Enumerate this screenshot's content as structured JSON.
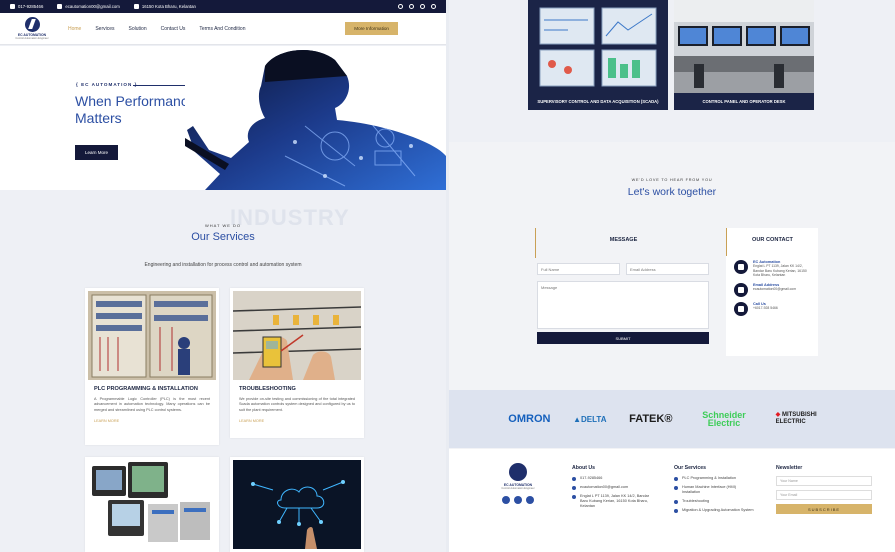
{
  "topbar": {
    "phone": "017-9285466",
    "email": "ecautomation00@gmail.com",
    "address": "16150 Kota Bharu, Kelantan"
  },
  "nav": {
    "brand": "EC AUTOMATION",
    "brand_sub": "Control Automation Engineer",
    "items": [
      "Home",
      "Services",
      "Solution",
      "Contact Us",
      "Terms And Condition"
    ],
    "active": "Home",
    "more_button": "More Information"
  },
  "hero": {
    "tag": "EC AUTOMATION",
    "title": "When Performance Matters",
    "button": "Learn More"
  },
  "services": {
    "kicker": "WHAT WE DO",
    "title": "Our Services",
    "watermark": "INDUSTRY",
    "description": "Engineering and installation for process control and automation system",
    "cards": [
      {
        "title": "PLC PROGRAMMING & INSTALLATION",
        "text": "A Programmable Logic Controller (PLC) is the most recent advancement in automation technology. Many operations can be merged and streamlined using PLC control systems.",
        "link": "LEARN MORE"
      },
      {
        "title": "TROUBLESHOOTING",
        "text": "We provide on-site testing and commissioning of the total integrated Scada automation controls system designed and configured by us to suit the plant requirement.",
        "link": "LEARN MORE"
      }
    ]
  },
  "showcase": [
    {
      "caption": "SUPERVISORY CONTROL AND DATA ACQUISITION (SCADA)"
    },
    {
      "caption": "CONTROL PANEL AND OPERATOR DESK"
    }
  ],
  "contact": {
    "kicker": "WE'D LOVE TO HEAR FROM YOU",
    "title": "Let's work together",
    "form_title": "MESSAGE",
    "full_name_placeholder": "Full Name",
    "email_placeholder": "Email Address",
    "message_placeholder": "Message",
    "submit": "SUBMIT",
    "office_title": "OUR CONTACT",
    "office": [
      {
        "label": "EC Automation",
        "value": "Englat L PT 1139, Jalan KK 14/2, Bandar Baru Kubang Kerian, 16150 Kota Bharu, Kelantan"
      },
      {
        "label": "Email Address",
        "value": "ecautomation00@gmail.com"
      },
      {
        "label": "Call Us",
        "value": "+6017-928 5466"
      }
    ]
  },
  "brands": [
    {
      "name": "OMRON",
      "color": "#1560bd"
    },
    {
      "name": "DELTA",
      "color": "#1d6fb8"
    },
    {
      "name": "FATEK®",
      "color": "#1c1c1c"
    },
    {
      "name": "Schneider Electric",
      "color": "#3dcd58"
    },
    {
      "name": "MITSUBISHI ELECTRIC",
      "color": "#222222"
    }
  ],
  "footer": {
    "brand": "EC AUTOMATION",
    "brand_sub": "Control Automation Engineer",
    "about_title": "About Us",
    "about": [
      "017-9285466",
      "ecautomation00@gmail.com",
      "Englat L PT 1139, Jalan KK 14/2, Bandar Baru Kubang Kerian, 16150 Kota Bharu, Kelantan"
    ],
    "services_title": "Our Services",
    "services": [
      "PLC Programming & Installation",
      "Human Machine Interface (HMI) Installation",
      "Troubleshooting",
      "Migration & Upgrading Automation System"
    ],
    "newsletter_title": "Newsletter",
    "name_placeholder": "Your Name",
    "email_placeholder": "Your Email",
    "subscribe": "SUBSCRIBE"
  },
  "colors": {
    "navy": "#14193a",
    "accent_blue": "#2c4fa3",
    "gold": "#d7b46a"
  }
}
